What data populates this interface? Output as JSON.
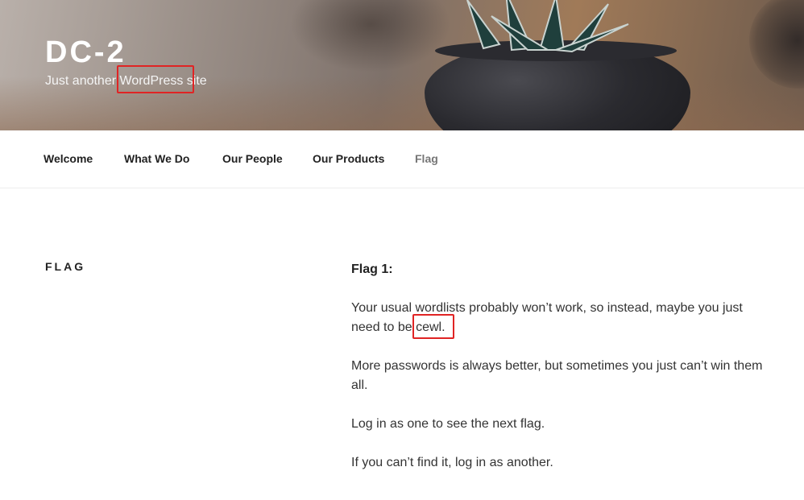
{
  "site": {
    "title": "DC-2",
    "description_pre": "Just another ",
    "description_highlight": "WordPress",
    "description_post": " site"
  },
  "nav": {
    "items": [
      {
        "label": "Welcome",
        "current": false
      },
      {
        "label": "What We Do",
        "current": false
      },
      {
        "label": "Our People",
        "current": false
      },
      {
        "label": "Our Products",
        "current": false
      },
      {
        "label": "Flag",
        "current": true
      }
    ]
  },
  "page": {
    "title": "FLAG",
    "heading": "Flag 1:",
    "para1_pre": "Your usual wordlists probably won’t work, so instead, maybe you just need to be ",
    "para1_highlight": "cewl.",
    "para2": "More passwords is always better, but sometimes you just can’t win them all.",
    "para3": "Log in as one to see the next flag.",
    "para4": "If you can’t find it, log in as another."
  },
  "colors": {
    "highlight_box": "#e02424",
    "nav_current": "#767676",
    "text": "#333333"
  }
}
